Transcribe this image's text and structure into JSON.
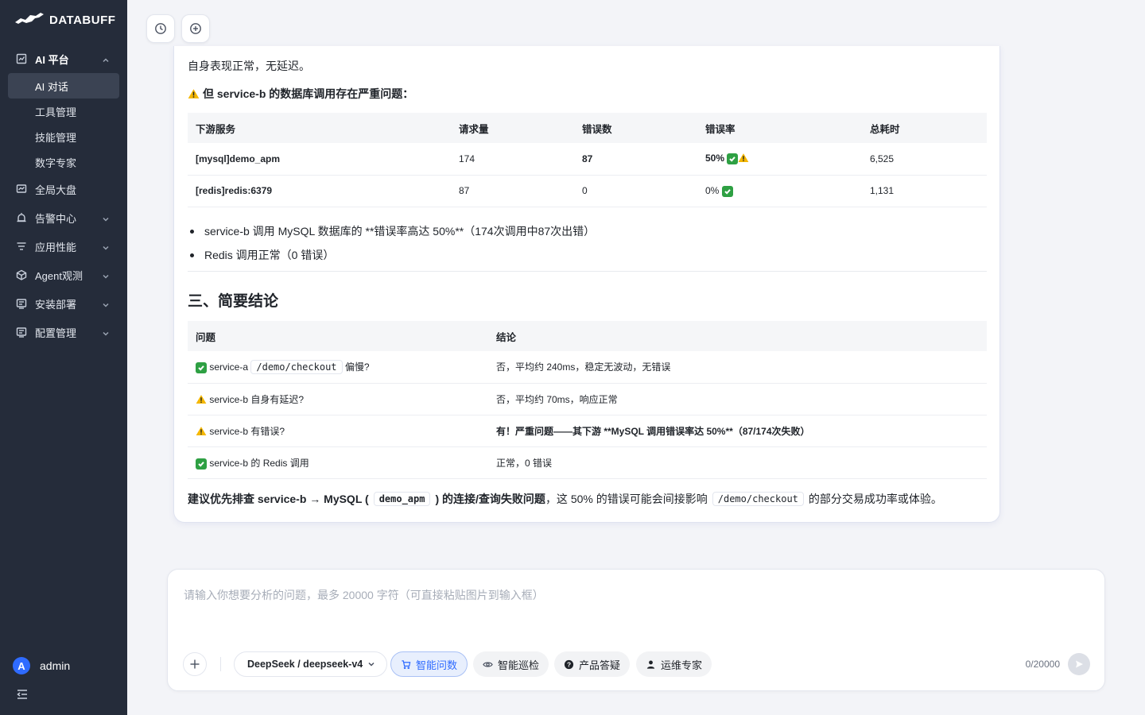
{
  "app": {
    "logo_text": "DATABUFF"
  },
  "sidebar": {
    "ai_platform": "AI 平台",
    "sub_items": [
      "AI 对话",
      "工具管理",
      "技能管理",
      "数字专家"
    ],
    "items": [
      {
        "label": "全局大盘",
        "icon": "dashboard-icon"
      },
      {
        "label": "告警中心",
        "icon": "alarm-icon"
      },
      {
        "label": "应用性能",
        "icon": "apm-icon"
      },
      {
        "label": "Agent观测",
        "icon": "cube-icon"
      },
      {
        "label": "安装部署",
        "icon": "deploy-icon"
      },
      {
        "label": "配置管理",
        "icon": "config-icon"
      }
    ],
    "user": {
      "avatar_letter": "A",
      "name": "admin"
    }
  },
  "message": {
    "intro": "自身表现正常，无延迟。",
    "warning_heading": "但 service-b 的数据库调用存在严重问题：",
    "downstream_table": {
      "headers": [
        "下游服务",
        "请求量",
        "错误数",
        "错误率",
        "总耗时"
      ],
      "rows": [
        [
          "[mysql]demo_apm",
          "174",
          "87",
          "50%",
          "6,525"
        ],
        [
          "[redis]redis:6379",
          "87",
          "0",
          "0%",
          "1,131"
        ]
      ]
    },
    "bullets": [
      "service-b 调用 MySQL 数据库的 **错误率高达 50%**（174次调用中87次出错）",
      "Redis 调用正常（0 错误）"
    ],
    "section_title": "三、简要结论",
    "summary_table": {
      "headers": [
        "问题",
        "结论"
      ],
      "rows": [
        {
          "q_prefix": "service-a",
          "q_code": "/demo/checkout",
          "q_suffix": "偏慢?",
          "a": "否，平均约 240ms，稳定无波动，无错误"
        },
        {
          "q": "service-b 自身有延迟?",
          "a": "否，平均约 70ms，响应正常"
        },
        {
          "q": "service-b 有错误?",
          "a": "有！严重问题——其下游 **MySQL 调用错误率达 50%**（87/174次失败）"
        },
        {
          "q": "service-b 的 Redis 调用",
          "a": "正常，0 错误"
        }
      ]
    },
    "conclusion": {
      "part1": "建议优先排查 service-b → MySQL (",
      "code1": "demo_apm",
      "part2": ") 的连接/查询失败问题",
      "part3": "，这 50% 的错误可能会间接影响",
      "code2": "/demo/checkout",
      "part4": "的部分交易成功率或体验。"
    }
  },
  "input": {
    "placeholder": "请输入你想要分析的问题，最多 20000 字符（可直接粘贴图片到输入框）",
    "model": "DeepSeek / deepseek-v4",
    "chips": [
      "智能问数",
      "智能巡检",
      "产品答疑",
      "运维专家"
    ],
    "counter": "0/20000"
  },
  "colors": {
    "accent": "#2f6bff",
    "sidebar_bg": "#252c3a",
    "success": "#2ea043",
    "warning": "#f5b700"
  }
}
